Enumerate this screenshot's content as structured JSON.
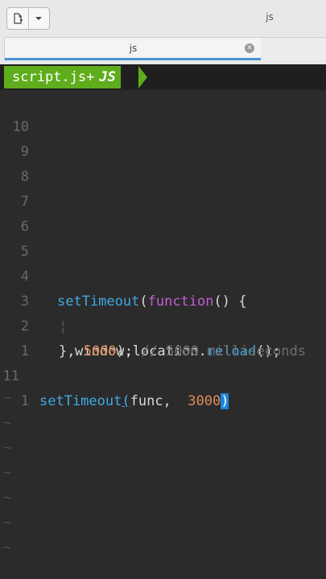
{
  "window": {
    "title": "js"
  },
  "toolbar": {
    "new_icon": "new-document-icon",
    "dropdown_icon": "chevron-down-icon"
  },
  "tab": {
    "label": "js",
    "close_icon": "close-circle-icon",
    "accent": "#4a90d9"
  },
  "statusline": {
    "filename": "script.js+",
    "filetype": "JS",
    "color": "#5fad1d"
  },
  "editor": {
    "lines": [
      {
        "num": "10"
      },
      {
        "num": "9"
      },
      {
        "num": "8"
      },
      {
        "num": "7"
      },
      {
        "num": "6"
      },
      {
        "num": "5"
      },
      {
        "num": "4",
        "t1": "setTimeout",
        "t2": "(",
        "t3": "function",
        "t4": "() {"
      },
      {
        "num": "3",
        "guide": "¦",
        "t1": "window",
        "t2": ".location.",
        "t3": "reload",
        "t4": "();"
      },
      {
        "num": "2",
        "t1": "}, ",
        "t2": "5000",
        "t3": "); ",
        "t4": "// 5000 milliseconds"
      },
      {
        "num": "1"
      },
      {
        "num": "11",
        "t1": "setTimeout",
        "t2": "(",
        "t3": "func,  ",
        "t4": "3000",
        "t5": ")"
      },
      {
        "num": "1"
      }
    ],
    "tilde": "~"
  }
}
